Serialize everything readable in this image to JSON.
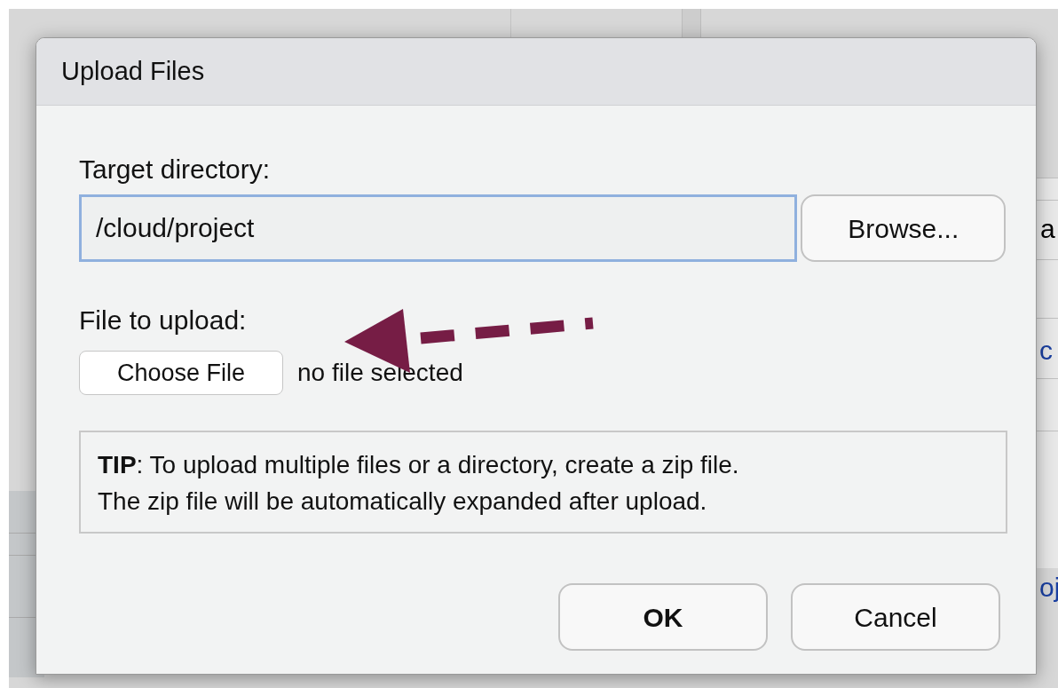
{
  "dialog": {
    "title": "Upload Files",
    "target_label": "Target directory:",
    "target_value": "/cloud/project",
    "browse_button": "Browse...",
    "file_label": "File to upload:",
    "choose_button": "Choose File",
    "file_status": "no file selected",
    "tip": "**TIP**: To upload multiple files or a directory, create a zip file.\nThe zip file will be automatically expanded after upload.",
    "buttons": [
      {
        "label": "OK",
        "kind": "primary"
      },
      {
        "label": "Cancel",
        "kind": "secondary"
      }
    ]
  },
  "background_fragments": [
    {
      "text": "a",
      "kind": "plain"
    },
    {
      "text": "c",
      "kind": "link"
    },
    {
      "text": "oj",
      "kind": "link"
    }
  ]
}
